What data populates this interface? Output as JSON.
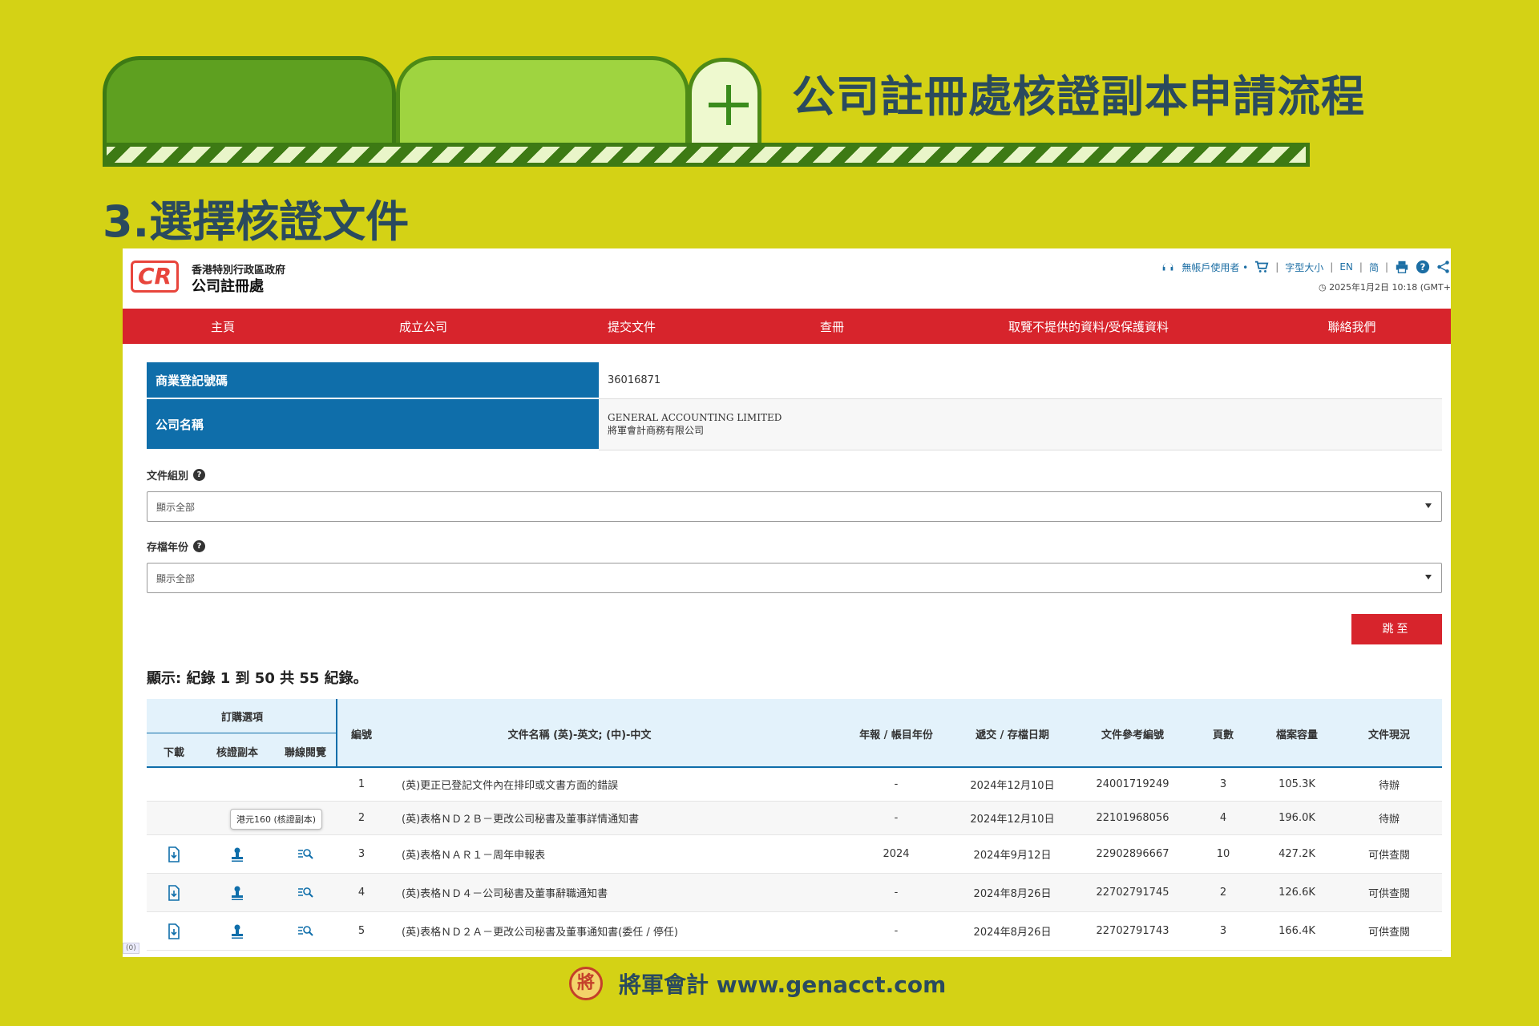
{
  "slide": {
    "title": "公司註冊處核證副本申請流程",
    "step_title": "3.選擇核證文件",
    "footer_text": "將軍會計 www.genacct.com",
    "seal_glyph": "將"
  },
  "header": {
    "logo_text": "CR",
    "org_line1": "香港特別行政區政府",
    "org_line2": "公司註冊處",
    "user_label": "無帳戶使用者 •",
    "font_size_label": "字型大小",
    "lang_en": "EN",
    "lang_sc": "简",
    "datetime": "2025年1月2日 10:18 (GMT+"
  },
  "nav": {
    "items": [
      "主頁",
      "成立公司",
      "提交文件",
      "查冊",
      "取覽不提供的資料/受保護資料",
      "聯絡我們"
    ]
  },
  "company": {
    "brn_label": "商業登記號碼",
    "brn_value": "36016871",
    "name_label": "公司名稱",
    "name_en": "GENERAL ACCOUNTING LIMITED",
    "name_zh": "將軍會計商務有限公司"
  },
  "filters": {
    "doc_group_label": "文件組別",
    "doc_group_value": "顯示全部",
    "year_label": "存檔年份",
    "year_value": "顯示全部",
    "go_label": "跳至"
  },
  "records_summary": "顯示: 紀錄 1 到 50 共 55 紀錄。",
  "table": {
    "order_options": "訂購選項",
    "col_download": "下載",
    "col_certified": "核證副本",
    "col_online": "聯線閱覽",
    "col_no": "編號",
    "col_name": "文件名稱 (英)-英文; (中)-中文",
    "col_year": "年報 / 帳目年份",
    "col_date": "遞交 / 存檔日期",
    "col_ref": "文件參考編號",
    "col_pages": "頁數",
    "col_size": "檔案容量",
    "col_status": "文件現況",
    "tooltip": "港元160 (核證副本)",
    "rows": [
      {
        "no": "1",
        "name": "(英)更正已登記文件內在排印或文書方面的錯誤",
        "year": "-",
        "date": "2024年12月10日",
        "ref": "24001719249",
        "pages": "3",
        "size": "105.3K",
        "status": "待辦"
      },
      {
        "no": "2",
        "name": "(英)表格ＮＤ２Ｂ－更改公司秘書及董事詳情通知書",
        "year": "-",
        "date": "2024年12月10日",
        "ref": "22101968056",
        "pages": "4",
        "size": "196.0K",
        "status": "待辦"
      },
      {
        "no": "3",
        "name": "(英)表格ＮＡＲ１－周年申報表",
        "year": "2024",
        "date": "2024年9月12日",
        "ref": "22902896667",
        "pages": "10",
        "size": "427.2K",
        "status": "可供查閱"
      },
      {
        "no": "4",
        "name": "(英)表格ＮＤ４－公司秘書及董事辭職通知書",
        "year": "-",
        "date": "2024年8月26日",
        "ref": "22702791745",
        "pages": "2",
        "size": "126.6K",
        "status": "可供查閱"
      },
      {
        "no": "5",
        "name": "(英)表格ＮＤ２Ａ－更改公司秘書及董事通知書(委任 / 停任)",
        "year": "-",
        "date": "2024年8月26日",
        "ref": "22702791743",
        "pages": "3",
        "size": "166.4K",
        "status": "可供查閱"
      }
    ]
  },
  "corner_badge": "(0)",
  "colors": {
    "background": "#d4d215",
    "nav_red": "#d7242c",
    "label_blue": "#0f6eaa",
    "title_text": "#2a4a5e"
  }
}
